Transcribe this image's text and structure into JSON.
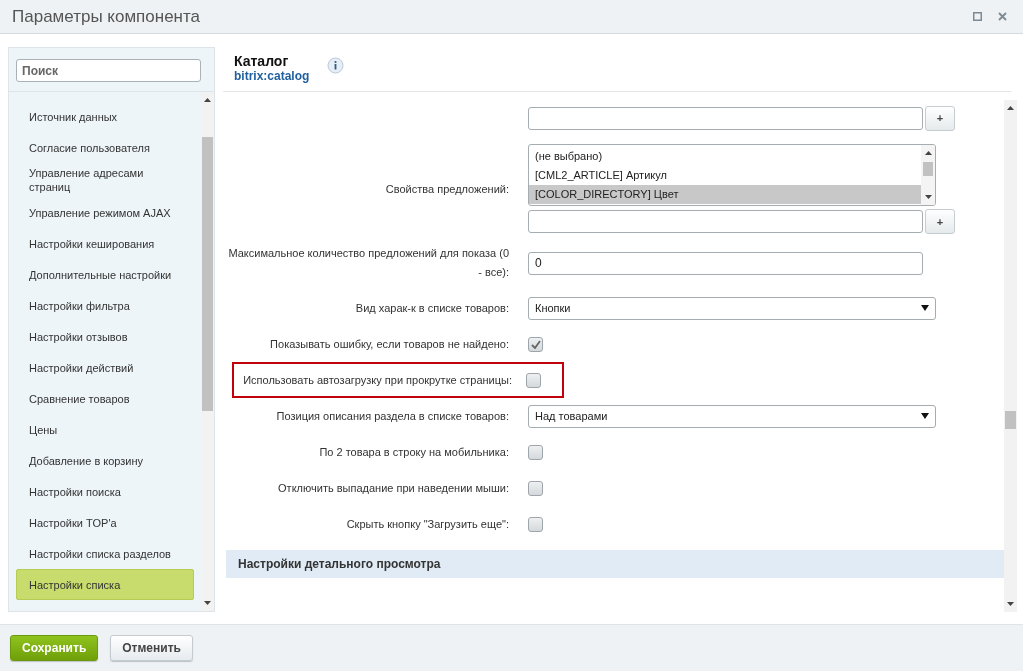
{
  "window": {
    "title": "Параметры компонента"
  },
  "sidebar": {
    "search": {
      "placeholder": "Поиск"
    },
    "items": [
      {
        "label": "Источник данных",
        "selected": false
      },
      {
        "label": "Согласие пользователя",
        "selected": false
      },
      {
        "label": "Управление адресами страниц",
        "selected": false
      },
      {
        "label": "Управление режимом AJAX",
        "selected": false
      },
      {
        "label": "Настройки кеширования",
        "selected": false
      },
      {
        "label": "Дополнительные настройки",
        "selected": false
      },
      {
        "label": "Настройки фильтра",
        "selected": false
      },
      {
        "label": "Настройки отзывов",
        "selected": false
      },
      {
        "label": "Настройки действий",
        "selected": false
      },
      {
        "label": "Сравнение товаров",
        "selected": false
      },
      {
        "label": "Цены",
        "selected": false
      },
      {
        "label": "Добавление в корзину",
        "selected": false
      },
      {
        "label": "Настройки поиска",
        "selected": false
      },
      {
        "label": "Настройки TOP'а",
        "selected": false
      },
      {
        "label": "Настройки списка разделов",
        "selected": false
      },
      {
        "label": "Настройки списка",
        "selected": true
      }
    ]
  },
  "component": {
    "title": "Каталог",
    "code": "bitrix:catalog"
  },
  "rows": [
    {
      "kind": "input_plus",
      "button": "+",
      "highlighted": false
    },
    {
      "kind": "multiselect",
      "label": "Свойства предложений:",
      "options": [
        {
          "label": "(не выбрано)",
          "selected": false
        },
        {
          "label": "[CML2_ARTICLE] Артикул",
          "selected": false
        },
        {
          "label": "[COLOR_DIRECTORY] Цвет",
          "selected": true
        }
      ],
      "button": "+",
      "highlighted": false
    },
    {
      "kind": "input",
      "label": "Максимальное количество предложений для показа (0 - все):",
      "value": "0",
      "highlighted": false
    },
    {
      "kind": "select",
      "label": "Вид харак-к в списке товаров:",
      "value": "Кнопки",
      "highlighted": false
    },
    {
      "kind": "checkbox",
      "label": "Показывать ошибку, если товаров не найдено:",
      "checked": true,
      "highlighted": false
    },
    {
      "kind": "checkbox",
      "label": "Использовать автозагрузку при прокрутке страницы:",
      "checked": false,
      "highlighted": true
    },
    {
      "kind": "select",
      "label": "Позиция описания раздела в списке товаров:",
      "value": "Над товарами",
      "highlighted": false
    },
    {
      "kind": "checkbox",
      "label": "По 2 товара в строку на мобильника:",
      "checked": false,
      "highlighted": false
    },
    {
      "kind": "checkbox",
      "label": "Отключить выпадание при наведении мыши:",
      "checked": false,
      "highlighted": false
    },
    {
      "kind": "checkbox",
      "label": "Скрыть кнопку \"Загрузить еще\":",
      "checked": false,
      "highlighted": false
    }
  ],
  "section": {
    "title": "Настройки детального просмотра"
  },
  "buttons": [
    {
      "label": "Сохранить",
      "kind": "primary"
    },
    {
      "label": "Отменить",
      "kind": "secondary"
    }
  ]
}
